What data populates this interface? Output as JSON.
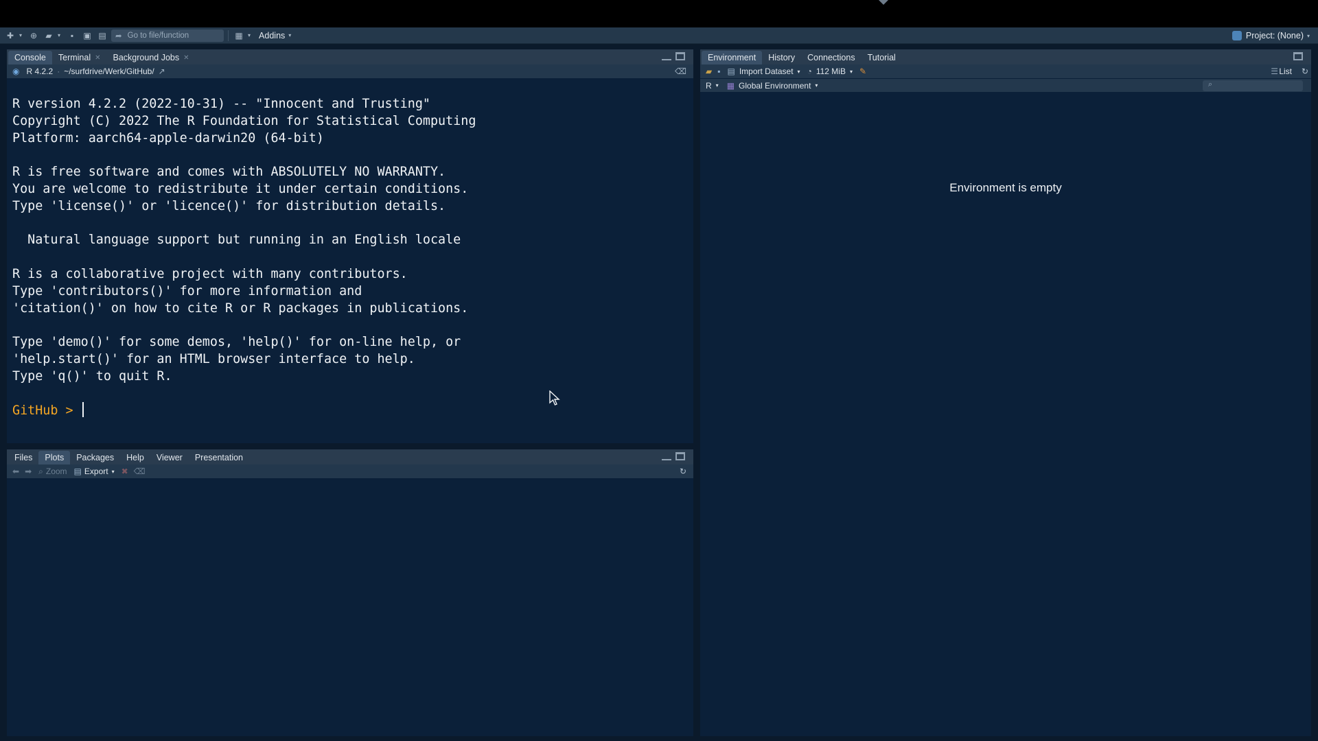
{
  "toolbar": {
    "goto_placeholder": "Go to file/function",
    "addins_label": "Addins",
    "project_label": "Project: (None)"
  },
  "console_pane": {
    "tabs": [
      {
        "label": "Console"
      },
      {
        "label": "Terminal"
      },
      {
        "label": "Background Jobs"
      }
    ],
    "r_version": "R 4.2.2",
    "path": "~/surfdrive/Werk/GitHub/",
    "lines": [
      "R version 4.2.2 (2022-10-31) -- \"Innocent and Trusting\"",
      "Copyright (C) 2022 The R Foundation for Statistical Computing",
      "Platform: aarch64-apple-darwin20 (64-bit)",
      "",
      "R is free software and comes with ABSOLUTELY NO WARRANTY.",
      "You are welcome to redistribute it under certain conditions.",
      "Type 'license()' or 'licence()' for distribution details.",
      "",
      "  Natural language support but running in an English locale",
      "",
      "R is a collaborative project with many contributors.",
      "Type 'contributors()' for more information and",
      "'citation()' on how to cite R or R packages in publications.",
      "",
      "Type 'demo()' for some demos, 'help()' for on-line help, or",
      "'help.start()' for an HTML browser interface to help.",
      "Type 'q()' to quit R.",
      ""
    ],
    "prompt": "GitHub > "
  },
  "files_pane": {
    "tabs": [
      {
        "label": "Files"
      },
      {
        "label": "Plots"
      },
      {
        "label": "Packages"
      },
      {
        "label": "Help"
      },
      {
        "label": "Viewer"
      },
      {
        "label": "Presentation"
      }
    ],
    "zoom_label": "Zoom",
    "export_label": "Export"
  },
  "env_pane": {
    "tabs": [
      {
        "label": "Environment"
      },
      {
        "label": "History"
      },
      {
        "label": "Connections"
      },
      {
        "label": "Tutorial"
      }
    ],
    "import_label": "Import Dataset",
    "memory_label": "112 MiB",
    "list_label": "List",
    "lang_label": "R",
    "scope_label": "Global Environment",
    "empty_message": "Environment is empty"
  }
}
